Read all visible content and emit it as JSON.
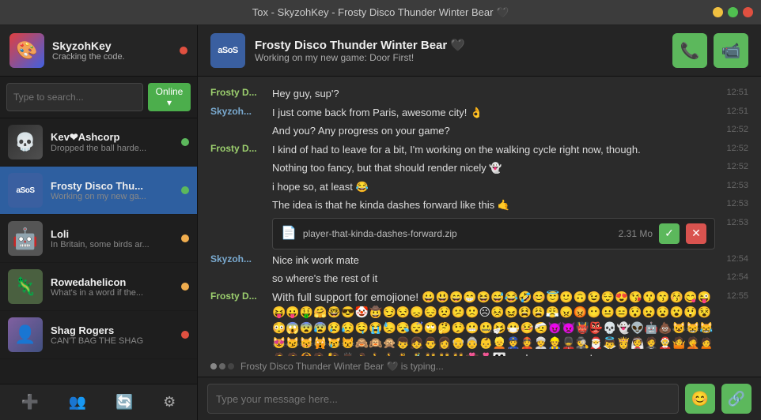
{
  "titlebar": {
    "title": "Tox - SkyzohKey - Frosty Disco Thunder Winter Bear 🖤"
  },
  "sidebar": {
    "profile": {
      "name": "SkyzohKey",
      "status": "Cracking the code.",
      "avatar": "🎨"
    },
    "search": {
      "placeholder": "Type to search...",
      "online_label": "Online ▾"
    },
    "contacts": [
      {
        "id": "kev",
        "name": "Kev❤Ashcorp",
        "preview": "Dropped the ball harde...",
        "status": "online",
        "avatar": "💀"
      },
      {
        "id": "frosty",
        "name": "Frosty Disco Thu...",
        "preview": "Working on my new ga...",
        "status": "online",
        "avatar": "aSoS",
        "active": true
      },
      {
        "id": "loli",
        "name": "Loli",
        "preview": "In Britain, some birds ar...",
        "status": "away",
        "avatar": "🤖"
      },
      {
        "id": "roweda",
        "name": "Rowedahelicon",
        "preview": "What's in a word if the...",
        "status": "away",
        "avatar": "🦎"
      },
      {
        "id": "shag",
        "name": "Shag Rogers",
        "preview": "CAN'T BAG THE SHAG",
        "status": "offline",
        "avatar": "👤"
      }
    ],
    "bottom_buttons": [
      "➕",
      "👥",
      "🔄",
      "⚙"
    ]
  },
  "chat": {
    "header": {
      "avatar_text": "aSoS",
      "name": "Frosty Disco Thunder Winter Bear 🖤",
      "status": "Working on my new game: Door First!"
    },
    "messages": [
      {
        "sender": "Frosty D...",
        "sender_class": "other",
        "text": "Hey guy, sup'?",
        "time": "12:51"
      },
      {
        "sender": "Skyzoh...",
        "sender_class": "self",
        "text": "I just come back from Paris, awesome city! 👌",
        "time": "12:51"
      },
      {
        "sender": "",
        "text": "And you? Any progress on your game?",
        "time": "12:52",
        "continuation": true
      },
      {
        "sender": "Frosty D...",
        "sender_class": "other",
        "text": "I kind of had to leave for a bit, I'm working on the walking cycle right now, though.",
        "time": "12:52"
      },
      {
        "sender": "",
        "text": "Nothing too fancy, but that should render nicely 👻",
        "time": "12:52",
        "continuation": true
      },
      {
        "sender": "",
        "text": "i hope so, at least 😂",
        "time": "12:53",
        "continuation": true
      },
      {
        "sender": "",
        "text": "The idea is that he kinda dashes forward like this 🤙",
        "time": "12:53",
        "continuation": true
      },
      {
        "sender": "",
        "text": "",
        "time": "12:53",
        "is_file": true,
        "file_name": "player-that-kinda-dashes-forward.zip",
        "file_size": "2.31 Mo",
        "continuation": true
      },
      {
        "sender": "Skyzoh...",
        "sender_class": "self",
        "text": "Nice ink work mate",
        "time": "12:54"
      },
      {
        "sender": "",
        "text": "so where's the rest of it",
        "time": "12:54",
        "continuation": true
      },
      {
        "sender": "Frosty D...",
        "sender_class": "other",
        "text": "With full support for emojione! 😀😃😄😁😆😅😂🤣😊😇🙂🙃😉😌😍😘😗😙😚😋😜😝😛🤑🤗🤓😎🤡🤠😏😒😞😔😟😕🙁☹😣😖😫😩😤😠😡😶😐😑😯😦😧😮😲😵😳😱😨😰😢😥🤤😭😓😪😴🙄🤔🤥😬🤐🤧😷🤒🤕😈👿👹👺💀👻👽🤖💩😺😸😹😻😼😽🙀😿😾🙈🙉🙊👦👧👨👩👴👵👶👱👮👲👳👷💂🕵🎅👼👸👰🤵🤶🤷🤦🙍🙎🙅🙆💁🙋🙇🤰🚶🏃💃🕺👫👬👭💏💑👪 and many more !",
        "time": "12:55",
        "is_emoji_rich": true
      }
    ],
    "typing": {
      "text": "Frosty Disco Thunder Winter Bear 🖤 is typing..."
    },
    "input": {
      "placeholder": "Type your message here..."
    }
  }
}
